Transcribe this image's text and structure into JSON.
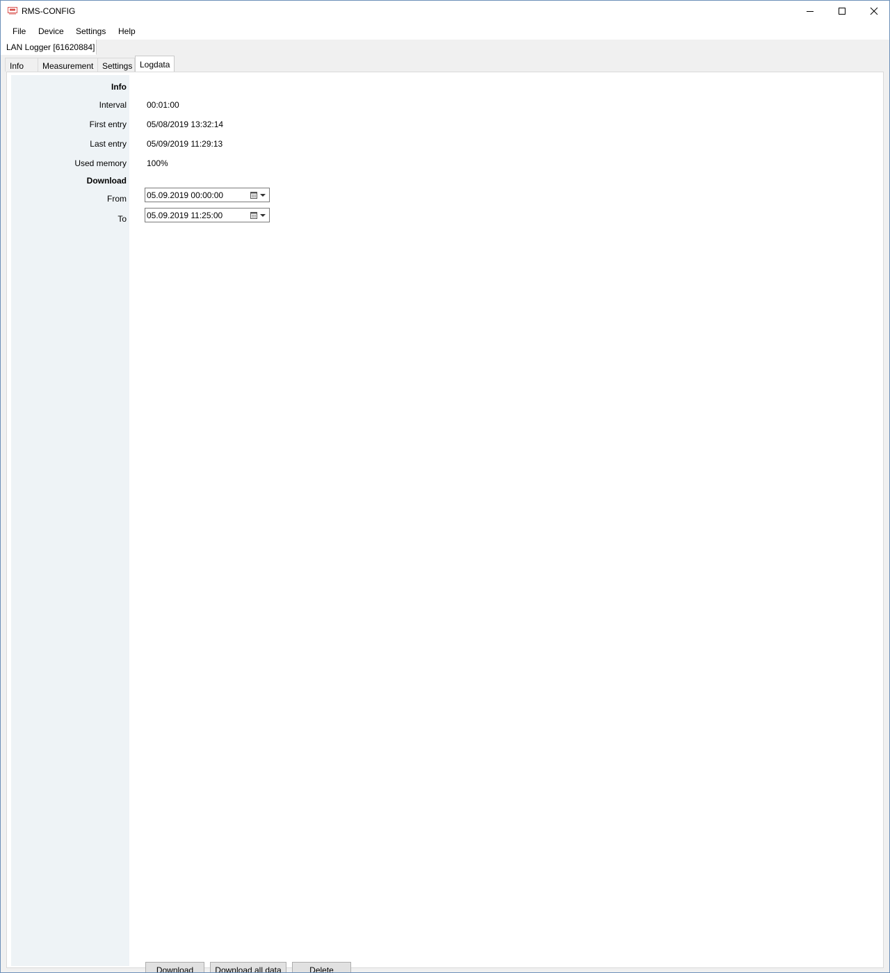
{
  "window": {
    "title": "RMS-CONFIG",
    "minimize_icon": "minimize-icon",
    "maximize_icon": "maximize-icon",
    "close_icon": "close-icon"
  },
  "menu": {
    "items": [
      "File",
      "Device",
      "Settings",
      "Help"
    ]
  },
  "document_tab": {
    "label": "LAN Logger [61620884]"
  },
  "tabs": {
    "items": [
      "Info",
      "Measurement",
      "Settings",
      "Logdata"
    ],
    "active": "Logdata"
  },
  "logdata": {
    "info_header": "Info",
    "interval": {
      "label": "Interval",
      "value": "00:01:00"
    },
    "first_entry": {
      "label": "First entry",
      "value": "05/08/2019 13:32:14"
    },
    "last_entry": {
      "label": "Last entry",
      "value": "05/09/2019 11:29:13"
    },
    "used_memory": {
      "label": "Used memory",
      "value": "100%"
    },
    "download_header": "Download",
    "from": {
      "label": "From",
      "value": "05.09.2019 00:00:00"
    },
    "to": {
      "label": "To",
      "value": "05.09.2019 11:25:00"
    }
  },
  "buttons": {
    "download": "Download",
    "download_all": "Download all data",
    "delete": "Delete"
  },
  "colors": {
    "label_column_bg": "#eef3f6",
    "window_border": "#6b8fb8",
    "app_icon": "#d9534f"
  }
}
